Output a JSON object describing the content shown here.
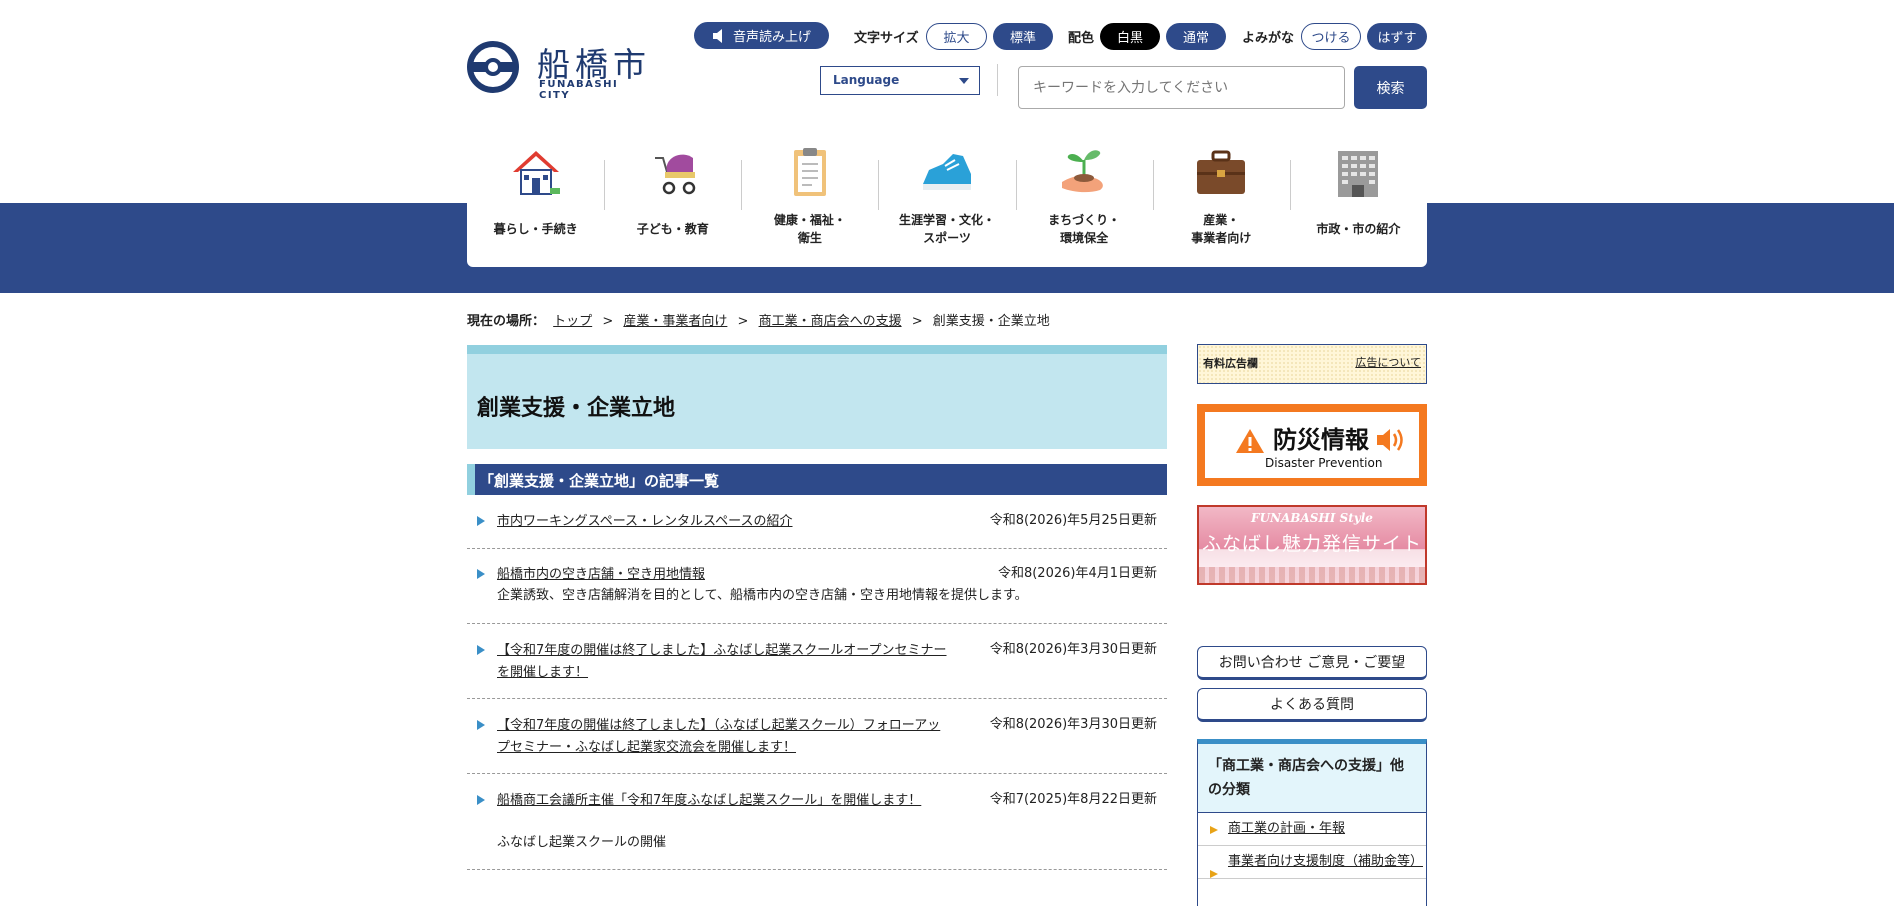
{
  "header": {
    "logo_jp": "船橋市",
    "logo_en": "FUNABASHI CITY",
    "read_aloud": "音声読み上げ",
    "font_size_label": "文字サイズ",
    "font_enlarge": "拡大",
    "font_standard": "標準",
    "color_label": "配色",
    "color_bw": "白黒",
    "color_normal": "通常",
    "yomigana_label": "よみがな",
    "yomigana_on": "つける",
    "yomigana_off": "はずす",
    "language": "Language",
    "search_placeholder": "キーワードを入力してください",
    "search_button": "検索"
  },
  "nav": [
    {
      "label": "暮らし・手続き",
      "icon": "house-icon"
    },
    {
      "label": "子ども・教育",
      "icon": "stroller-icon"
    },
    {
      "label": "健康・福祉・\n衛生",
      "icon": "clipboard-icon"
    },
    {
      "label": "生涯学習・文化・\nスポーツ",
      "icon": "sneaker-icon"
    },
    {
      "label": "まちづくり・\n環境保全",
      "icon": "sprout-icon"
    },
    {
      "label": "産業・\n事業者向け",
      "icon": "briefcase-icon"
    },
    {
      "label": "市政・市の紹介",
      "icon": "building-icon"
    }
  ],
  "breadcrumb": {
    "label": "現在の場所：",
    "links": [
      "トップ",
      "産業・事業者向け",
      "商工業・商店会への支援"
    ],
    "sep": ">",
    "current": "創業支援・企業立地"
  },
  "main": {
    "title": "創業支援・企業立地",
    "list_heading": "「創業支援・企業立地」の記事一覧",
    "articles": [
      {
        "title": "市内ワーキングスペース・レンタルスペースの紹介",
        "date": "令和8(2026)年5月25日更新",
        "desc": ""
      },
      {
        "title": "船橋市内の空き店舗・空き用地情報",
        "date": "令和8(2026)年4月1日更新",
        "desc": "企業誘致、空き店舗解消を目的として、船橋市内の空き店舗・空き用地情報を提供します。"
      },
      {
        "title": "【令和7年度の開催は終了しました】ふなばし起業スクールオープンセミナーを開催します！",
        "date": "令和8(2026)年3月30日更新",
        "desc": ""
      },
      {
        "title": "【令和7年度の開催は終了しました】（ふなばし起業スクール）フォローアップセミナー・ふなばし起業家交流会を開催します！",
        "date": "令和8(2026)年3月30日更新",
        "desc": ""
      },
      {
        "title": "船橋商工会議所主催「令和7年度ふなばし起業スクール」を開催します！",
        "date": "令和7(2025)年8月22日更新",
        "desc": "ふなばし起業スクールの開催"
      }
    ]
  },
  "sidebar": {
    "ad_label": "有料広告欄",
    "ad_link": "広告について",
    "bousai_jp": "防災情報",
    "bousai_en": "Disaster Prevention",
    "shop_style": "FUNABASHI Style",
    "shop_title": "ふなばし魅力発信サイト",
    "contact": "お問い合わせ ご意見・ご要望",
    "faq": "よくある質問",
    "category_heading": "「商工業・商店会への支援」他の分類",
    "category_items": [
      "商工業の計画・年報",
      "事業者向け支援制度（補助金等）"
    ]
  },
  "colors": {
    "primary": "#2e4a8a",
    "accent_light": "#c2e6ef",
    "accent": "#91d0df",
    "bousai": "#f47920"
  }
}
